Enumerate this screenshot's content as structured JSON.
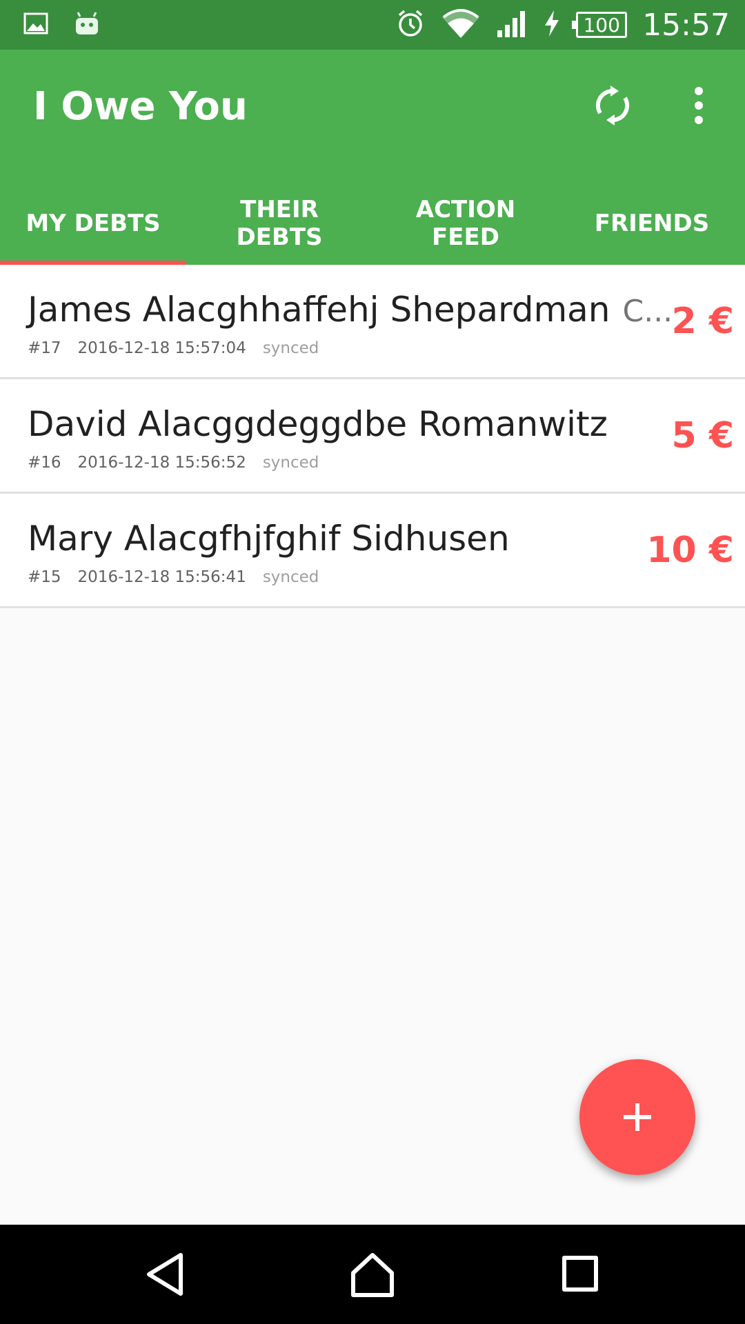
{
  "status_bar": {
    "time": "15:57",
    "battery": "100",
    "icons": [
      "image-icon",
      "android-icon",
      "alarm-icon",
      "wifi-icon",
      "signal-icon",
      "charging-icon",
      "battery-icon"
    ]
  },
  "app": {
    "title": "I Owe You",
    "actions": [
      "refresh-icon",
      "more-vert-icon"
    ]
  },
  "tabs": [
    {
      "label": "MY DEBTS",
      "selected": true
    },
    {
      "label": "THEIR\nDEBTS",
      "selected": false
    },
    {
      "label": "ACTION\nFEED",
      "selected": false
    },
    {
      "label": "FRIENDS",
      "selected": false
    }
  ],
  "debts": [
    {
      "name": "James Alacghhaffehj Shepardman",
      "extra": "C...",
      "id": "#17",
      "timestamp": "2016-12-18 15:57:04",
      "status": "synced",
      "amount": "2 €"
    },
    {
      "name": "David Alacggdeggdbe Romanwitz",
      "extra": "",
      "id": "#16",
      "timestamp": "2016-12-18 15:56:52",
      "status": "synced",
      "amount": "5 €"
    },
    {
      "name": "Mary Alacgfhjfghif Sidhusen",
      "extra": "",
      "id": "#15",
      "timestamp": "2016-12-18 15:56:41",
      "status": "synced",
      "amount": "10 €"
    }
  ],
  "colors": {
    "primary": "#4caf50",
    "primary_dark": "#388e3c",
    "accent": "#ff5252"
  }
}
